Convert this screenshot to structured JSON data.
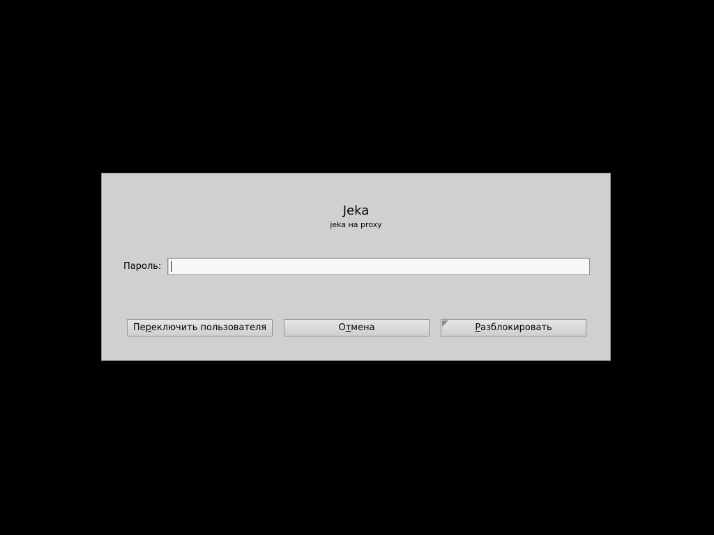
{
  "dialog": {
    "user_name": "Jeka",
    "user_host": "jeka на proxy",
    "password_label": "Пароль:",
    "password_value": "",
    "buttons": {
      "switch_user": {
        "before": "Пе",
        "mnemonic": "р",
        "after": "еключить пользователя"
      },
      "cancel": {
        "before": "О",
        "mnemonic": "т",
        "after": "мена"
      },
      "unlock": {
        "before": "",
        "mnemonic": "Р",
        "after": "азблокировать"
      }
    }
  }
}
